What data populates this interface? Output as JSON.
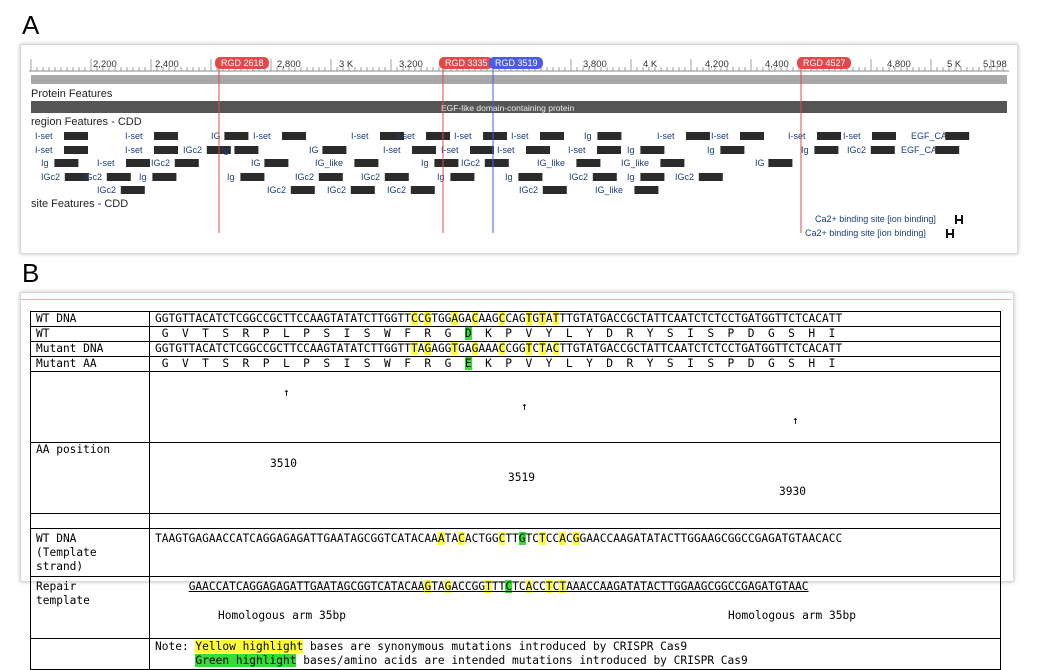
{
  "panels": {
    "a": "A",
    "b": "B"
  },
  "panel_a": {
    "ruler": {
      "ticks": [
        "2,200",
        "2,400",
        "2,800",
        "3 K",
        "3,200",
        "3,800",
        "4 K",
        "4,200",
        "4,400",
        "4,800",
        "5 K",
        "5,198"
      ],
      "markers": [
        {
          "label": "RGD 2618",
          "color": "#e24a4a"
        },
        {
          "label": "RGD 3335",
          "color": "#e24a4a"
        },
        {
          "label": "RGD 3519",
          "color": "#4a5ce0"
        },
        {
          "label": "RGD 4527",
          "color": "#e24a4a"
        }
      ]
    },
    "protein_features_label": "Protein Features",
    "protein_bar_label": "EGF-like domain-containing protein",
    "region_label": "region Features - CDD",
    "region_rows": [
      [
        "I-set",
        "I-set",
        "IG",
        "I-set",
        "I-set",
        "I-set",
        "I-set",
        "I-set",
        "Ig",
        "I-set",
        "I-set",
        "I-set",
        "I-set",
        "EGF_CA"
      ],
      [
        "I-set",
        "I-set",
        "IGc2",
        "Ig",
        "IG",
        "I-set",
        "I-set",
        "I-set",
        "I-set",
        "Ig",
        "Ig",
        "Ig",
        "IGc2",
        "EGF_CA"
      ],
      [
        "Ig",
        "I-set",
        "IGc2",
        "IG",
        "IG_like",
        "Ig",
        "IGc2",
        "IG_like",
        "IG_like",
        "IG"
      ],
      [
        "IGc2",
        "IGc2",
        "Ig",
        "Ig",
        "IGc2",
        "IGc2",
        "Ig",
        "Ig",
        "IGc2",
        "Ig",
        "IGc2"
      ],
      [
        "IGc2",
        "IGc2",
        "IGc2",
        "IGc2",
        "IGc2",
        "IG_like"
      ]
    ],
    "site_label": "site Features - CDD",
    "site_items": [
      "Ca2+ binding site [ion binding]",
      "Ca2+ binding site [ion binding]"
    ]
  },
  "panel_b": {
    "rows": {
      "wt_dna": "WT DNA",
      "wt": "WT",
      "mutant_dna": "Mutant DNA",
      "mutant_aa": "Mutant AA",
      "aa_position": "AA position",
      "wt_template": "WT DNA\n(Template\nstrand)",
      "repair": "Repair\ntemplate"
    },
    "positions": [
      "3510",
      "3519",
      "3930"
    ],
    "arrow": "↑",
    "homology_left": "Homologous arm 35bp",
    "homology_right": "Homologous arm 35bp",
    "note_prefix": "Note: ",
    "note_yellow": "Yellow highlight",
    "note_yellow_rest": " bases are synonymous mutations introduced by CRISPR Cas9",
    "note_green": "Green highlight",
    "note_green_rest": " bases/amino acids are intended mutations introduced by CRISPR Cas9",
    "highlight_colors": {
      "yellow": "#ffff33",
      "green": "#33dd33"
    }
  }
}
